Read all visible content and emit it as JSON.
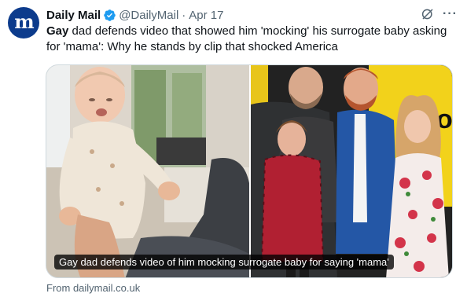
{
  "account": {
    "avatar_letter": "m",
    "display_name": "Daily Mail",
    "handle": "@DailyMail",
    "date": "Apr 17",
    "verified_color": "#1d9bf0"
  },
  "tweet": {
    "highlight": "Gay",
    "text_rest": " dad defends video that showed him 'mocking' his surrogate baby asking for 'mama': Why he stands by clip that shocked America"
  },
  "media": {
    "caption": "Gay dad defends video of him mocking surrogate baby for saying 'mama'",
    "background_sign": "or"
  },
  "card": {
    "source": "From dailymail.co.uk"
  },
  "icons": {
    "verified": "verified-badge-icon",
    "grok": "grok-icon",
    "more": "more-options-icon"
  }
}
